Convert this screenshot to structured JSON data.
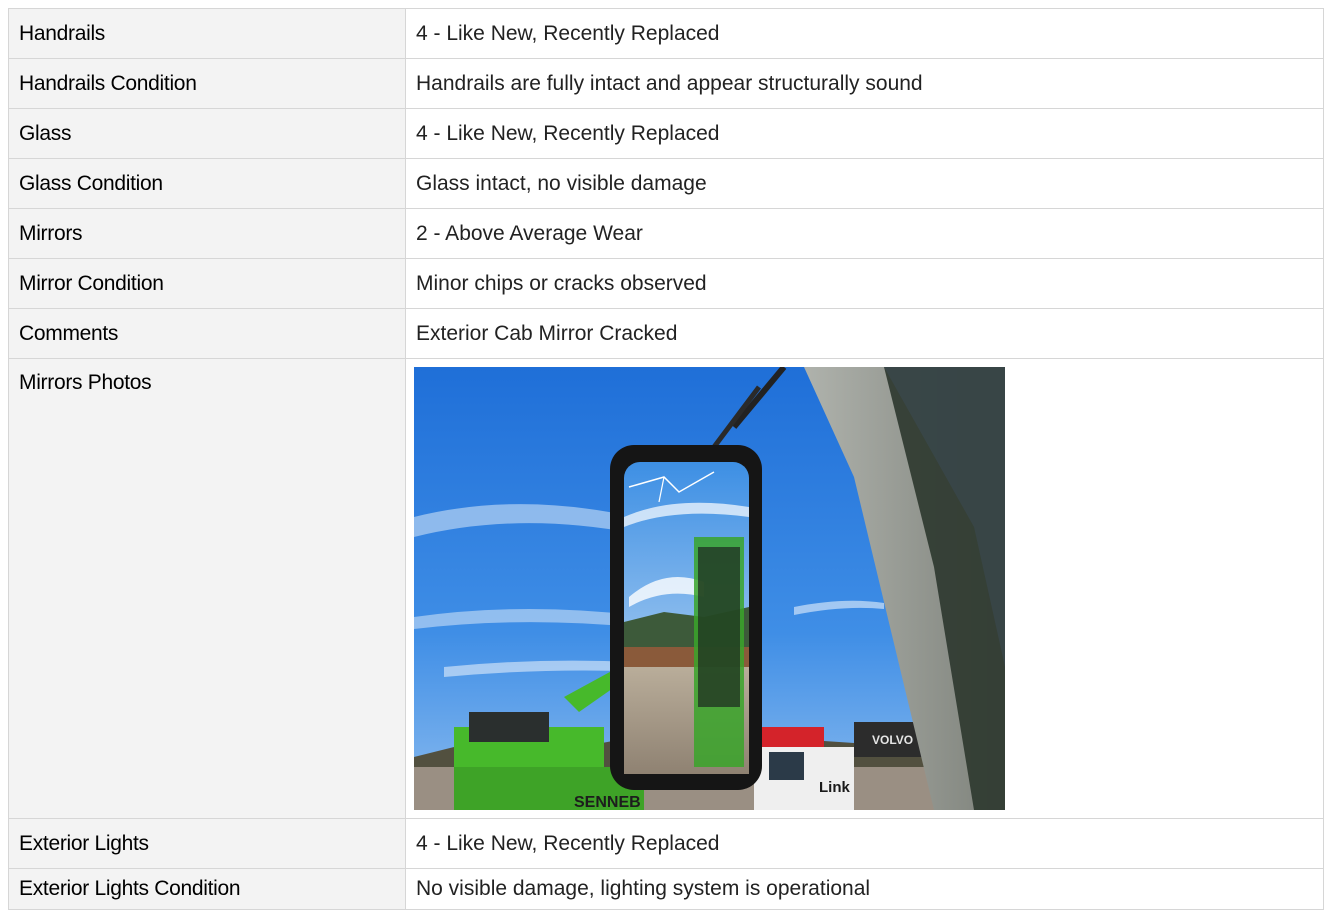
{
  "rows": [
    {
      "label": "Handrails",
      "value": "4 - Like New, Recently Replaced"
    },
    {
      "label": "Handrails Condition",
      "value": "Handrails are fully intact and appear structurally sound"
    },
    {
      "label": "Glass",
      "value": "4 - Like New, Recently Replaced"
    },
    {
      "label": "Glass Condition",
      "value": "Glass intact, no visible damage"
    },
    {
      "label": "Mirrors",
      "value": "2 - Above Average Wear"
    },
    {
      "label": "Mirror Condition",
      "value": "Minor chips or cracks observed"
    },
    {
      "label": "Comments",
      "value": "Exterior Cab Mirror Cracked"
    }
  ],
  "photos_row": {
    "label": "Mirrors Photos",
    "photo_text": {
      "brand_left": "SENNEB",
      "brand_right": "VOLVO",
      "truck_text": "Link"
    }
  },
  "rows_after": [
    {
      "label": "Exterior Lights",
      "value": "4 - Like New, Recently Replaced"
    },
    {
      "label": "Exterior Lights Condition",
      "value": "No visible damage, lighting system is operational"
    }
  ],
  "colors": {
    "label_bg": "#f3f3f3",
    "border": "#d6d6d6",
    "sky": "#2f7fe0",
    "machine_green": "#47b92b",
    "cab_frame": "#8a8d86"
  }
}
